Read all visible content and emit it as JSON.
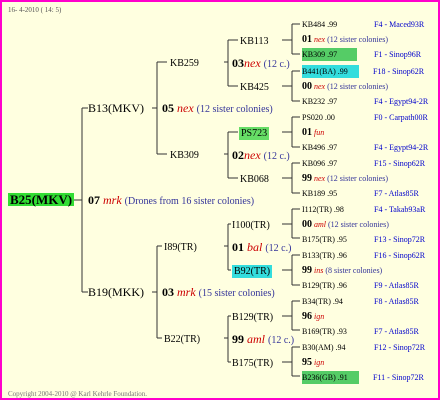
{
  "header": {
    "date": "16- 4-2010 ( 14: 5)"
  },
  "footer": {
    "copyright": "Copyright 2004-2010 @ Karl Kehrle Foundation."
  },
  "root": {
    "label": "B25(MKV)",
    "color": "#33dd33"
  },
  "center": {
    "num": "07",
    "code": "mrk",
    "desc": "(Drones from 16 sister colonies)"
  },
  "g1": [
    {
      "label": "B13(MKV)",
      "num": "05",
      "code": "nex",
      "desc": "(12 sister colonies)"
    },
    {
      "label": "B19(MKK)",
      "num": "03",
      "code": "mrk",
      "desc": "(15 sister colonies)"
    }
  ],
  "g2": [
    {
      "label": "KB259",
      "num": "03",
      "code": "nex",
      "desc": "(12 c.)"
    },
    {
      "label": "KB309",
      "num": "02",
      "code": "nex",
      "desc": "(12 c.)"
    },
    {
      "label": "I89(TR)",
      "num": "01",
      "code": "bal",
      "desc": "(12 c.)"
    },
    {
      "label": "B22(TR)",
      "num": "99",
      "code": "aml",
      "desc": "(12 c.)"
    }
  ],
  "g3": [
    {
      "label": "KB113"
    },
    {
      "label": "KB425"
    },
    {
      "label": "PS723"
    },
    {
      "label": "KB068"
    },
    {
      "label": "I100(TR)"
    },
    {
      "label": "B92(TR)"
    },
    {
      "label": "B129(TR)"
    },
    {
      "label": "B175(TR)"
    }
  ],
  "g4": [
    {
      "label": "KB484 .99",
      "loc": "F4 - Maced93R"
    },
    {
      "num": "01",
      "code": "nex",
      "desc": "(12 sister colonies)"
    },
    {
      "label": "KB309 .97",
      "loc": "F1 - Sinop96R"
    },
    {
      "label": "B441(BA) .99",
      "loc": "F18 - Sinop62R"
    },
    {
      "num": "00",
      "code": "nex",
      "desc": "(12 sister colonies)"
    },
    {
      "label": "KB232 .97",
      "loc": "F4 - Egypt94-2R"
    },
    {
      "label": "PS020 .00",
      "loc": "F0 - Carpath00R"
    },
    {
      "num": "01",
      "code": "fun",
      "desc": ""
    },
    {
      "label": "KB496 .97",
      "loc": "F4 - Egypt94-2R"
    },
    {
      "label": "KB096 .97",
      "loc": "F15 - Sinop62R"
    },
    {
      "num": "99",
      "code": "nex",
      "desc": "(12 sister colonies)"
    },
    {
      "label": "KB189 .95",
      "loc": "F7 - Atlas85R"
    },
    {
      "label": "I112(TR) .98",
      "loc": "F4 - Takab93aR"
    },
    {
      "num": "00",
      "code": "aml",
      "desc": "(12 sister colonies)"
    },
    {
      "label": "B175(TR) .95",
      "loc": "F13 - Sinop72R"
    },
    {
      "label": "B133(TR) .96",
      "loc": "F16 - Sinop62R"
    },
    {
      "num": "99",
      "code": "ins",
      "desc": "(8 sister colonies)"
    },
    {
      "label": "B129(TR) .96",
      "loc": "F9 - Atlas85R"
    },
    {
      "label": "B34(TR) .94",
      "loc": "F8 - Atlas85R"
    },
    {
      "num": "96",
      "code": "ign",
      "desc": ""
    },
    {
      "label": "B169(TR) .93",
      "loc": "F7 - Atlas85R"
    },
    {
      "label": "B30(AM) .94",
      "loc": "F12 - Sinop72R"
    },
    {
      "num": "95",
      "code": "ign",
      "desc": ""
    },
    {
      "label": "B236(GB) .91",
      "loc": "F11 - Sinop72R"
    }
  ]
}
